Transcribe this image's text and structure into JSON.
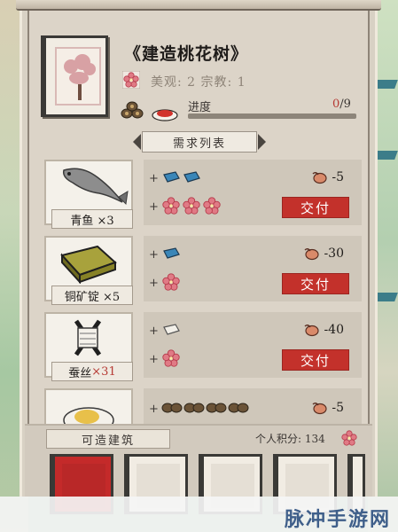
{
  "building": {
    "title": "《建造桃花树》",
    "stats": "美观: 2  宗教: 1",
    "progress_label": "进度",
    "progress_current": "0",
    "progress_total": "/9",
    "progress_fraction": 0
  },
  "requirements": {
    "header": "需求列表",
    "deliver_label": "交付",
    "rows": [
      {
        "name": "青鱼 ×3",
        "qty_red": "",
        "cost": "-5",
        "res1": 2,
        "res2": 3
      },
      {
        "name": "铜矿锭 ×5",
        "qty_red": "",
        "cost": "-30",
        "res1": 1,
        "res2": 1
      },
      {
        "name": "蚕丝 ",
        "qty_red": "×31",
        "cost": "-40",
        "res1": 1,
        "res2": 1
      },
      {
        "name": "",
        "qty_red": "",
        "cost": "-5",
        "res1": 4,
        "res2": 0
      }
    ]
  },
  "footer": {
    "buildable_label": "可造建筑",
    "points_label": "个人积分: 134"
  },
  "watermark": "脉冲手游网",
  "colors": {
    "accent_red": "#c3312b",
    "paper": "#dcd4c8",
    "blossom": "#d8a1a4"
  }
}
